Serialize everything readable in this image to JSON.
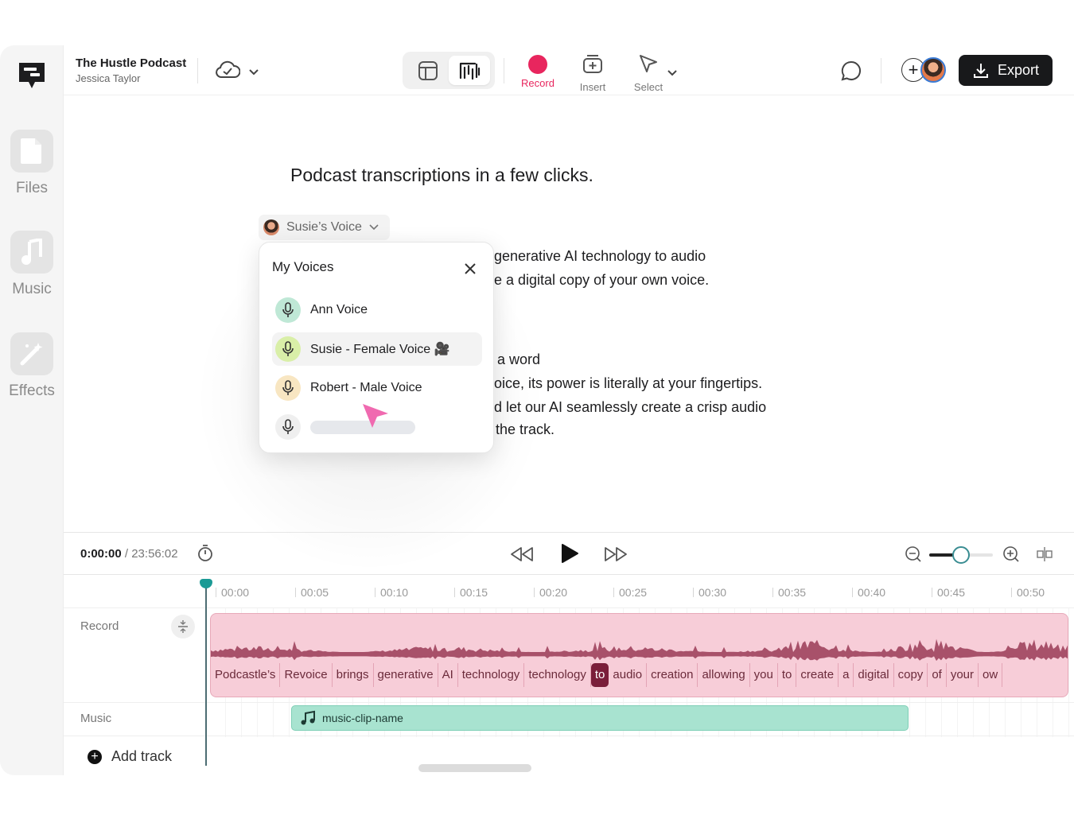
{
  "header": {
    "project_title": "The Hustle Podcast",
    "project_user": "Jessica Taylor",
    "tools": [
      {
        "label": "Record",
        "icon": "record-icon"
      },
      {
        "label": "Insert",
        "icon": "insert-icon"
      },
      {
        "label": "Select",
        "icon": "select-cursor-icon"
      }
    ],
    "export_label": "Export",
    "accent_color": "#e8265e"
  },
  "sidebar": {
    "items": [
      {
        "label": "Files",
        "icon": "file-icon"
      },
      {
        "label": "Music",
        "icon": "music-note-icon"
      },
      {
        "label": "Effects",
        "icon": "magic-wand-icon"
      }
    ]
  },
  "editor": {
    "title": "Podcast transcriptions in a few clicks.",
    "speaker": "Susie’s Voice",
    "paragraph1": [
      "generative AI technology to audio",
      "e a digital copy of your own voice."
    ],
    "paragraph2": [
      "a word",
      "oice, its power is literally at your fingertips.",
      "d let our AI seamlessly create a crisp audio",
      "the track."
    ]
  },
  "voices_popup": {
    "title": "My Voices",
    "voices": [
      {
        "label": "Ann Voice",
        "color": "#bfe8d6"
      },
      {
        "label": "Susie - Female Voice 🎥",
        "color": "#d9efa8"
      },
      {
        "label": "Robert - Male Voice",
        "color": "#f8e6c2"
      }
    ]
  },
  "player": {
    "current_time": "0:00:00",
    "separator": " / ",
    "duration": "23:56:02",
    "zoom_level": 0.5
  },
  "timeline": {
    "ticks": [
      "00:00",
      "00:05",
      "00:10",
      "00:15",
      "00:20",
      "00:25",
      "00:30",
      "00:35",
      "00:40",
      "00:45",
      "00:50"
    ],
    "tracks": [
      {
        "label": "Record"
      },
      {
        "label": "Music"
      }
    ],
    "words": [
      "Podcastle’s",
      "Revoice",
      "brings",
      "generative",
      "AI",
      "technology",
      "technology",
      "to",
      "audio",
      "creation",
      "allowing",
      "you",
      "to",
      "create",
      "a",
      "digital",
      "copy",
      "of",
      "your",
      "ow"
    ],
    "active_word_index": 7,
    "music_clip": "music-clip-name",
    "add_track_label": "Add track"
  }
}
